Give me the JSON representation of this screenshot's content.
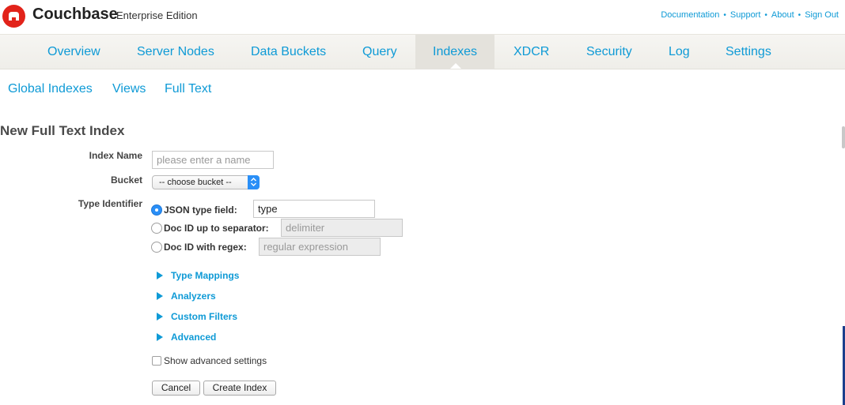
{
  "header": {
    "brand": "Couchbase",
    "edition": "Enterprise Edition",
    "links": [
      "Documentation",
      "Support",
      "About",
      "Sign Out"
    ],
    "separator": "•",
    "accent_color": "#0e9ad6",
    "logo_color": "#e2231a"
  },
  "main_nav": {
    "tabs": [
      "Overview",
      "Server Nodes",
      "Data Buckets",
      "Query",
      "Indexes",
      "XDCR",
      "Security",
      "Log",
      "Settings"
    ],
    "active": "Indexes"
  },
  "sub_nav": {
    "items": [
      "Global Indexes",
      "Views",
      "Full Text"
    ]
  },
  "form": {
    "title": "New Full Text Index",
    "index_name": {
      "label": "Index Name",
      "value": "",
      "placeholder": "please enter a name"
    },
    "bucket": {
      "label": "Bucket",
      "selected": "-- choose bucket --"
    },
    "type_identifier": {
      "label": "Type Identifier",
      "options": [
        {
          "label": "JSON type field:",
          "value": "type",
          "placeholder": "",
          "selected": true
        },
        {
          "label": "Doc ID up to separator:",
          "value": "",
          "placeholder": "delimiter",
          "selected": false
        },
        {
          "label": "Doc ID with regex:",
          "value": "",
          "placeholder": "regular expression",
          "selected": false
        }
      ]
    },
    "sections": [
      "Type Mappings",
      "Analyzers",
      "Custom Filters",
      "Advanced"
    ],
    "show_advanced": {
      "label": "Show advanced settings",
      "checked": false
    },
    "buttons": {
      "cancel": "Cancel",
      "create": "Create Index"
    }
  }
}
